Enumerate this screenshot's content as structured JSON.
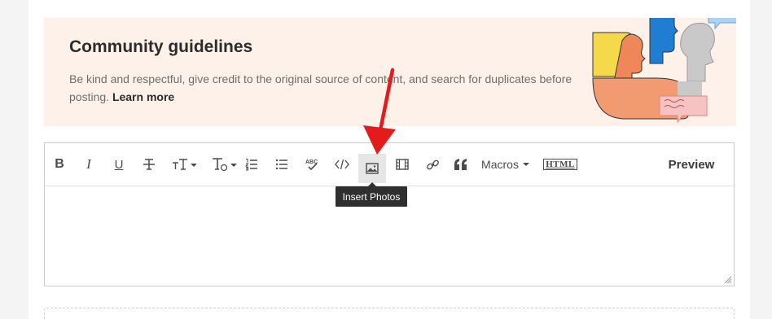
{
  "guidelines": {
    "title": "Community guidelines",
    "text": "Be kind and respectful, give credit to the original source of content, and search for duplicates before posting.",
    "learn_more": "Learn more"
  },
  "toolbar": {
    "bold": "B",
    "italic": "I",
    "underline": "U",
    "macros": "Macros",
    "html": "HTML",
    "preview": "Preview",
    "spellcheck_letters": "ABC"
  },
  "tooltip": {
    "insert_photos": "Insert Photos"
  },
  "colors": {
    "arrow": "#e31b1b",
    "banner_bg": "#fdf1e9"
  },
  "icons": [
    "strikethrough-icon",
    "font-size-icon",
    "font-style-icon",
    "numbered-list-icon",
    "bullet-list-icon",
    "spellcheck-icon",
    "code-icon",
    "image-icon",
    "video-icon",
    "link-icon",
    "quote-icon"
  ]
}
